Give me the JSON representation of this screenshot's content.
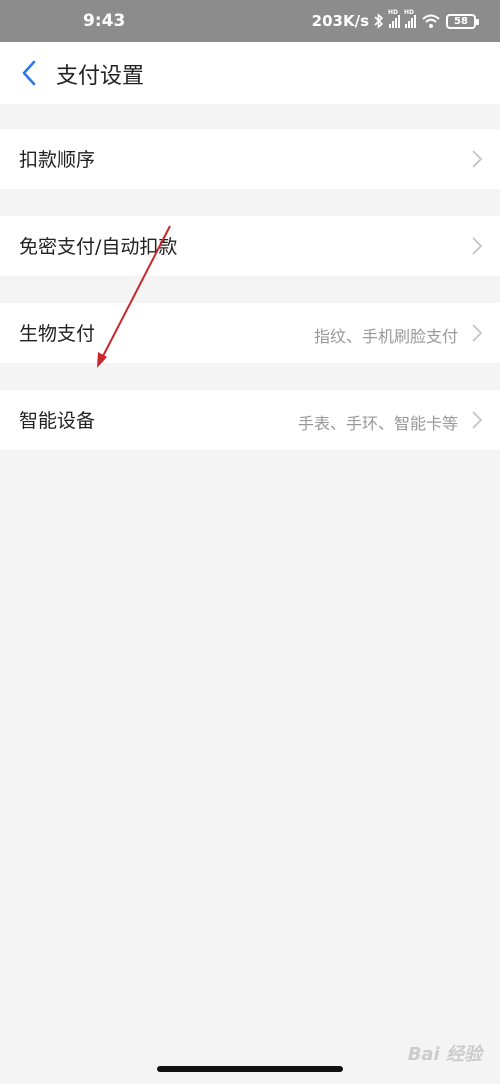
{
  "status_bar": {
    "time": "9:43",
    "network_speed": "203K/s",
    "battery": "58",
    "icons": [
      "bluetooth-icon",
      "signal-hd-icon",
      "signal-hd-icon",
      "wifi-icon",
      "battery-icon"
    ]
  },
  "header": {
    "title": "支付设置",
    "back_icon": "chevron-left-icon",
    "accent": "#2a78e4"
  },
  "settings": [
    {
      "label": "扣款顺序",
      "value": ""
    },
    {
      "label": "免密支付/自动扣款",
      "value": ""
    },
    {
      "label": "生物支付",
      "value": "指纹、手机刷脸支付"
    },
    {
      "label": "智能设备",
      "value": "手表、手环、智能卡等"
    }
  ],
  "annotation": {
    "color": "#c8282d"
  },
  "watermark": {
    "text": "Bai 经验"
  }
}
